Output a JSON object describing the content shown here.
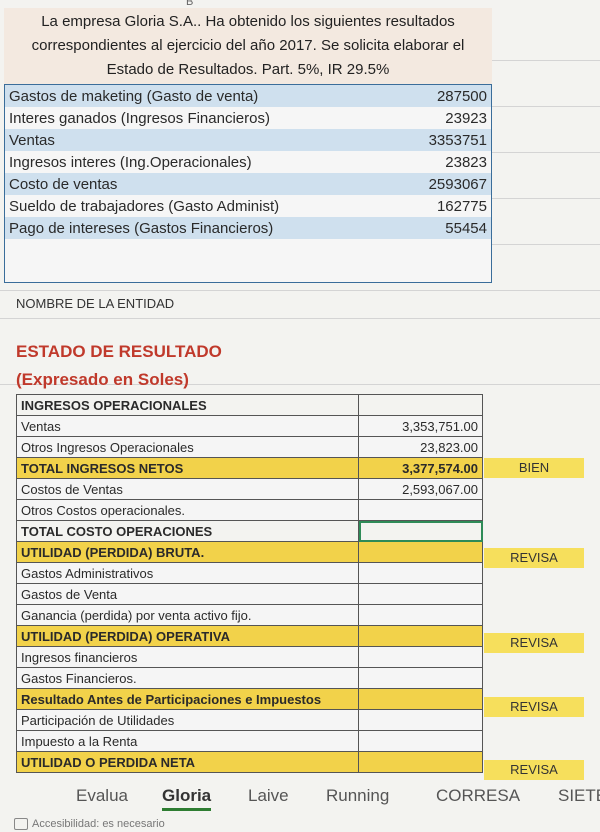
{
  "column_header": "B",
  "intro": [
    "La empresa Gloria S.A.. Ha obtenido los siguientes resultados",
    "correspondientes al ejercicio del año 2017. Se solicita elaborar el",
    "Estado de Resultados. Part. 5%, IR 29.5%"
  ],
  "data_rows": [
    {
      "label": "Gastos de maketing (Gasto de venta)",
      "value": "287500"
    },
    {
      "label": "Interes ganados (Ingresos Financieros)",
      "value": "23923"
    },
    {
      "label": "Ventas",
      "value": "3353751"
    },
    {
      "label": "Ingresos interes (Ing.Operacionales)",
      "value": "23823"
    },
    {
      "label": "Costo de ventas",
      "value": "2593067"
    },
    {
      "label": "Sueldo de trabajadores (Gasto Administ)",
      "value": "162775"
    },
    {
      "label": "Pago de intereses (Gastos Financieros)",
      "value": "55454"
    }
  ],
  "entity_label": "NOMBRE DE LA ENTIDAD",
  "report_title": "ESTADO DE RESULTADO",
  "report_subtitle": "(Expresado en  Soles)",
  "report_rows": [
    {
      "label": "INGRESOS OPERACIONALES",
      "value": "",
      "style": "bold"
    },
    {
      "label": "Ventas",
      "value": "3,353,751.00",
      "style": "plain"
    },
    {
      "label": "Otros Ingresos Operacionales",
      "value": "23,823.00",
      "style": "plain"
    },
    {
      "label": "TOTAL INGRESOS NETOS",
      "value": "3,377,574.00",
      "style": "hl"
    },
    {
      "label": "Costos de Ventas",
      "value": "2,593,067.00",
      "style": "plain"
    },
    {
      "label": "Otros Costos operacionales.",
      "value": "",
      "style": "plain"
    },
    {
      "label": "TOTAL COSTO OPERACIONES",
      "value": "",
      "style": "bold"
    },
    {
      "label": "UTILIDAD (PERDIDA) BRUTA.",
      "value": "",
      "style": "hl"
    },
    {
      "label": "Gastos Administrativos",
      "value": "",
      "style": "plain"
    },
    {
      "label": "Gastos de Venta",
      "value": "",
      "style": "plain"
    },
    {
      "label": "Ganancia (perdida) por venta activo fijo.",
      "value": "",
      "style": "plain"
    },
    {
      "label": "UTILIDAD (PERDIDA) OPERATIVA",
      "value": "",
      "style": "hl"
    },
    {
      "label": "Ingresos financieros",
      "value": "",
      "style": "plain"
    },
    {
      "label": "Gastos Financieros.",
      "value": "",
      "style": "plain"
    },
    {
      "label": "Resultado Antes de Participaciones e Impuestos",
      "value": "",
      "style": "hl"
    },
    {
      "label": "Participación de Utilidades",
      "value": "",
      "style": "plain"
    },
    {
      "label": "Impuesto a la Renta",
      "value": "",
      "style": "plain"
    },
    {
      "label": "UTILIDAD O PERDIDA NETA",
      "value": "",
      "style": "hl"
    }
  ],
  "badges": [
    {
      "text": "BIEN",
      "row": 3
    },
    {
      "text": "REVISA",
      "row": 7
    },
    {
      "text": "REVISA",
      "row": 11
    },
    {
      "text": "REVISA",
      "row": 14
    },
    {
      "text": "REVISA",
      "row": 17
    }
  ],
  "sheet_tabs": [
    {
      "label": "Evalua",
      "active": false
    },
    {
      "label": "Gloria",
      "active": true
    },
    {
      "label": "Laive",
      "active": false
    },
    {
      "label": "Running",
      "active": false
    },
    {
      "label": "CORRESA",
      "active": false
    },
    {
      "label": "SIETE",
      "active": false
    }
  ],
  "status_text": "Accesibilidad: es necesario"
}
